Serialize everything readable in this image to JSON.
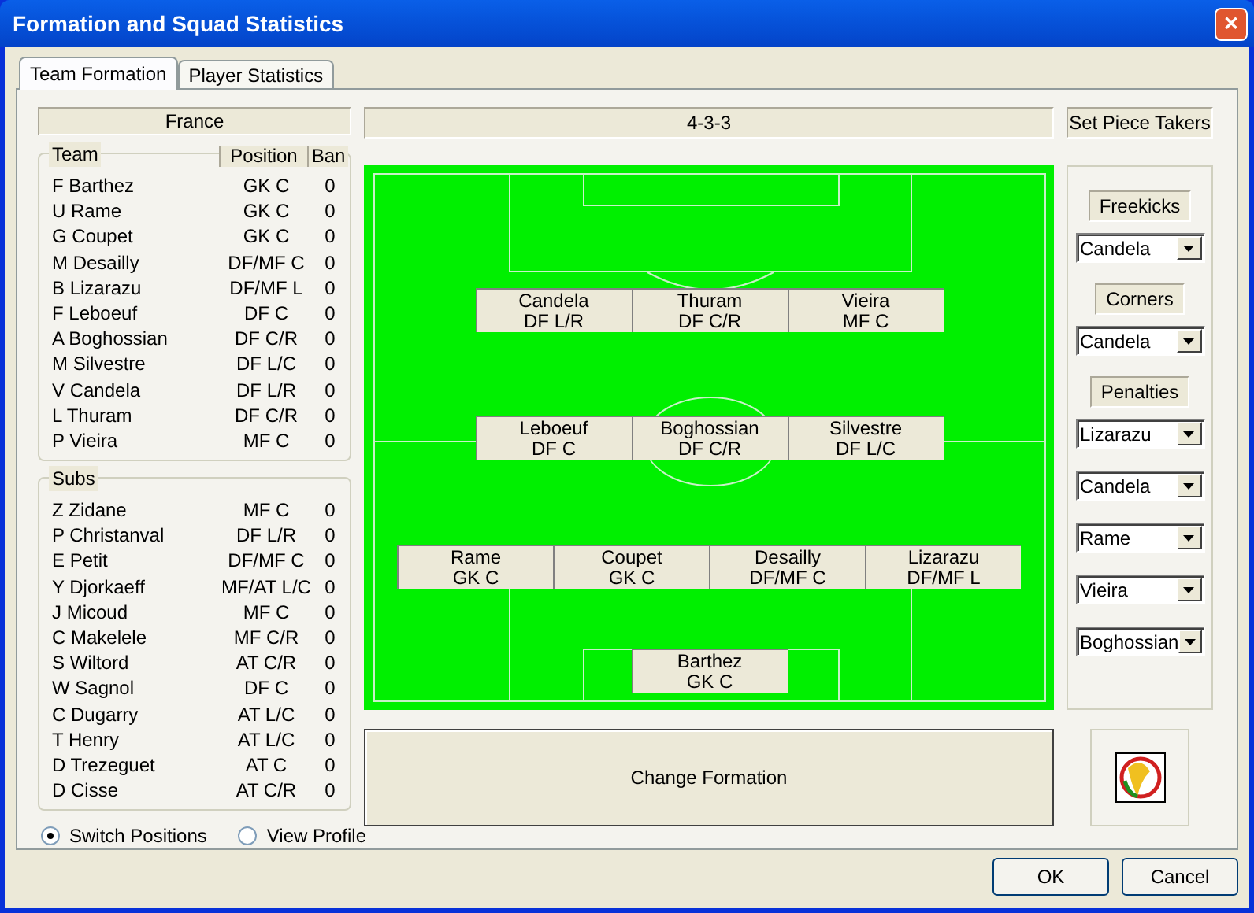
{
  "window": {
    "title": "Formation and Squad Statistics",
    "close": "✕"
  },
  "tabs": [
    {
      "label": "Team Formation",
      "selected": true
    },
    {
      "label": "Player Statistics",
      "selected": false
    }
  ],
  "team_name": "France",
  "columns": [
    "Position",
    "Ban"
  ],
  "team": {
    "label": "Team",
    "players": [
      {
        "name": "F Barthez",
        "position": "GK C",
        "ban": "0"
      },
      {
        "name": "U Rame",
        "position": "GK C",
        "ban": "0"
      },
      {
        "name": "G Coupet",
        "position": "GK C",
        "ban": "0"
      },
      {
        "name": "M Desailly",
        "position": "DF/MF C",
        "ban": "0"
      },
      {
        "name": "B Lizarazu",
        "position": "DF/MF L",
        "ban": "0"
      },
      {
        "name": "F Leboeuf",
        "position": "DF C",
        "ban": "0"
      },
      {
        "name": "A Boghossian",
        "position": "DF C/R",
        "ban": "0"
      },
      {
        "name": "M Silvestre",
        "position": "DF L/C",
        "ban": "0"
      },
      {
        "name": "V Candela",
        "position": "DF L/R",
        "ban": "0"
      },
      {
        "name": "L Thuram",
        "position": "DF C/R",
        "ban": "0"
      },
      {
        "name": "P Vieira",
        "position": "MF C",
        "ban": "0"
      }
    ]
  },
  "subs": {
    "label": "Subs",
    "players": [
      {
        "name": "Z Zidane",
        "position": "MF C",
        "ban": "0"
      },
      {
        "name": "P Christanval",
        "position": "DF L/R",
        "ban": "0"
      },
      {
        "name": "E Petit",
        "position": "DF/MF C",
        "ban": "0"
      },
      {
        "name": "Y Djorkaeff",
        "position": "MF/AT L/C",
        "ban": "0"
      },
      {
        "name": "J Micoud",
        "position": "MF C",
        "ban": "0"
      },
      {
        "name": "C Makelele",
        "position": "MF C/R",
        "ban": "0"
      },
      {
        "name": "S Wiltord",
        "position": "AT C/R",
        "ban": "0"
      },
      {
        "name": "W Sagnol",
        "position": "DF C",
        "ban": "0"
      },
      {
        "name": "C Dugarry",
        "position": "AT L/C",
        "ban": "0"
      },
      {
        "name": "T Henry",
        "position": "AT L/C",
        "ban": "0"
      },
      {
        "name": "D Trezeguet",
        "position": "AT C",
        "ban": "0"
      },
      {
        "name": "D Cisse",
        "position": "AT C/R",
        "ban": "0"
      }
    ]
  },
  "modes": [
    {
      "label": "Switch Positions",
      "selected": true
    },
    {
      "label": "View Profile",
      "selected": false
    }
  ],
  "formation": "4-3-3",
  "pitch_rows": [
    [
      {
        "name": "Candela",
        "position": "DF L/R"
      },
      {
        "name": "Thuram",
        "position": "DF C/R"
      },
      {
        "name": "Vieira",
        "position": "MF C"
      }
    ],
    [
      {
        "name": "Leboeuf",
        "position": "DF C"
      },
      {
        "name": "Boghossian",
        "position": "DF C/R"
      },
      {
        "name": "Silvestre",
        "position": "DF L/C"
      }
    ],
    [
      {
        "name": "Rame",
        "position": "GK C"
      },
      {
        "name": "Coupet",
        "position": "GK C"
      },
      {
        "name": "Desailly",
        "position": "DF/MF C"
      },
      {
        "name": "Lizarazu",
        "position": "DF/MF L"
      }
    ],
    [
      {
        "name": "Barthez",
        "position": "GK C"
      }
    ]
  ],
  "change_formation": "Change Formation",
  "set_piece_title": "Set Piece Takers",
  "set_pieces": [
    {
      "label": "Freekicks",
      "takers": [
        "Candela"
      ]
    },
    {
      "label": "Corners",
      "takers": [
        "Candela"
      ]
    },
    {
      "label": "Penalties",
      "takers": [
        "Lizarazu",
        "Candela",
        "Rame",
        "Vieira",
        "Boghossian"
      ]
    }
  ],
  "buttons": [
    "OK",
    "Cancel"
  ]
}
